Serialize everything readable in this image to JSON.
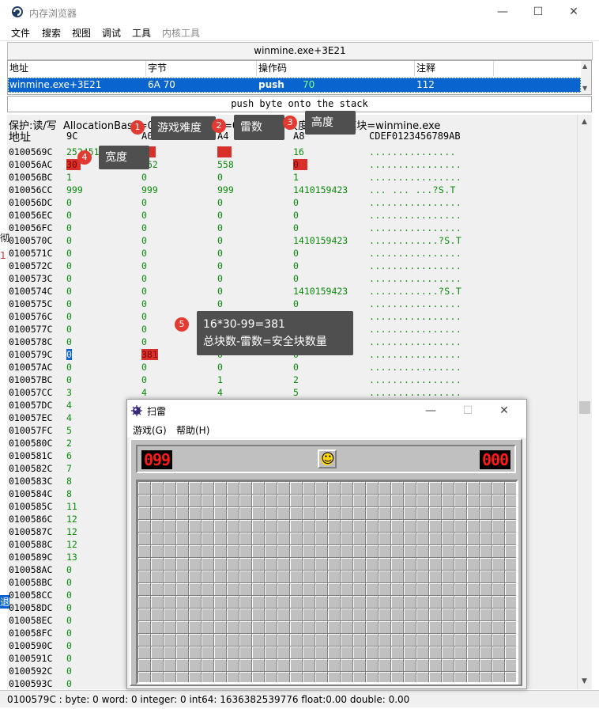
{
  "window": {
    "title": "内存浏览器",
    "minimize": "—",
    "maximize": "☐",
    "close": "✕"
  },
  "menu": [
    "文件",
    "搜索",
    "视图",
    "调试",
    "工具",
    "内核工具"
  ],
  "address_banner": "winmine.exe+3E21",
  "disasm": {
    "headers": [
      "地址",
      "字节",
      "操作码",
      "注释"
    ],
    "row": {
      "address": "winmine.exe+3E21",
      "bytes": "6A 70",
      "op": "push",
      "operand": "70",
      "comment": "112"
    }
  },
  "description": "push byte onto the stack",
  "info_line": "保护:读/写  AllocationBase=01000000 基址=01000000 尺度=1000 模块=winmine.exe",
  "address_header": "地址",
  "column_headers": [
    "9C",
    "A0",
    "A4",
    "A8",
    "CDEF0123456789AB"
  ],
  "hex_rows": [
    {
      "addr": "0100569C",
      "v": [
        "252451385",
        "",
        "",
        "16"
      ],
      "ascii": "...............",
      "hl": [
        1,
        2
      ]
    },
    {
      "addr": "010056AC",
      "v": [
        "30",
        "762",
        "558",
        "0"
      ],
      "ascii": "................",
      "hl": [
        0,
        3
      ]
    },
    {
      "addr": "010056BC",
      "v": [
        "1",
        "0",
        "0",
        "1"
      ],
      "ascii": "................",
      "hl": []
    },
    {
      "addr": "010056CC",
      "v": [
        "999",
        "999",
        "999",
        "1410159423"
      ],
      "ascii": " ... ... ...?S.T",
      "hl": []
    },
    {
      "addr": "010056DC",
      "v": [
        "0",
        "0",
        "0",
        "0"
      ],
      "ascii": "................",
      "hl": []
    },
    {
      "addr": "010056EC",
      "v": [
        "0",
        "0",
        "0",
        "0"
      ],
      "ascii": "................",
      "hl": []
    },
    {
      "addr": "010056FC",
      "v": [
        "0",
        "0",
        "0",
        "0"
      ],
      "ascii": "................",
      "hl": []
    },
    {
      "addr": "0100570C",
      "v": [
        "0",
        "0",
        "0",
        "1410159423"
      ],
      "ascii": "............?S.T",
      "hl": []
    },
    {
      "addr": "0100571C",
      "v": [
        "0",
        "0",
        "0",
        "0"
      ],
      "ascii": "................",
      "hl": []
    },
    {
      "addr": "0100572C",
      "v": [
        "0",
        "0",
        "0",
        "0"
      ],
      "ascii": "................",
      "hl": []
    },
    {
      "addr": "0100573C",
      "v": [
        "0",
        "0",
        "0",
        "0"
      ],
      "ascii": "................",
      "hl": []
    },
    {
      "addr": "0100574C",
      "v": [
        "0",
        "0",
        "0",
        "1410159423"
      ],
      "ascii": "............?S.T",
      "hl": []
    },
    {
      "addr": "0100575C",
      "v": [
        "0",
        "0",
        "0",
        "0"
      ],
      "ascii": "................",
      "hl": []
    },
    {
      "addr": "0100576C",
      "v": [
        "0",
        "0",
        "0",
        "0"
      ],
      "ascii": "................",
      "hl": []
    },
    {
      "addr": "0100577C",
      "v": [
        "0",
        "0",
        "0",
        "0"
      ],
      "ascii": "................",
      "hl": []
    },
    {
      "addr": "0100578C",
      "v": [
        "0",
        "0",
        "0",
        "0"
      ],
      "ascii": "................",
      "hl": []
    },
    {
      "addr": "0100579C",
      "v": [
        "0",
        "381",
        "0",
        "0"
      ],
      "ascii": "................",
      "hl": [
        1
      ]
    },
    {
      "addr": "010057AC",
      "v": [
        "0",
        "0",
        "0",
        "0"
      ],
      "ascii": "................",
      "hl": []
    },
    {
      "addr": "010057BC",
      "v": [
        "0",
        "0",
        "1",
        "2"
      ],
      "ascii": "................",
      "hl": []
    },
    {
      "addr": "010057CC",
      "v": [
        "3",
        "4",
        "4",
        "5"
      ],
      "ascii": "................",
      "hl": []
    },
    {
      "addr": "010057DC",
      "v": [
        "4",
        "",
        "",
        ""
      ],
      "ascii": "",
      "hl": []
    },
    {
      "addr": "010057EC",
      "v": [
        "4",
        "",
        "",
        ""
      ],
      "ascii": "",
      "hl": []
    },
    {
      "addr": "010057FC",
      "v": [
        "5",
        "",
        "",
        ""
      ],
      "ascii": "",
      "hl": []
    },
    {
      "addr": "0100580C",
      "v": [
        "2",
        "",
        "",
        ""
      ],
      "ascii": "",
      "hl": []
    },
    {
      "addr": "0100581C",
      "v": [
        "6",
        "",
        "",
        ""
      ],
      "ascii": "",
      "hl": []
    },
    {
      "addr": "0100582C",
      "v": [
        "7",
        "",
        "",
        ""
      ],
      "ascii": "",
      "hl": []
    },
    {
      "addr": "0100583C",
      "v": [
        "8",
        "",
        "",
        ""
      ],
      "ascii": "",
      "hl": []
    },
    {
      "addr": "0100584C",
      "v": [
        "8",
        "",
        "",
        ""
      ],
      "ascii": "",
      "hl": []
    },
    {
      "addr": "0100585C",
      "v": [
        "11",
        "",
        "",
        ""
      ],
      "ascii": "",
      "hl": []
    },
    {
      "addr": "0100586C",
      "v": [
        "12",
        "",
        "",
        ""
      ],
      "ascii": "",
      "hl": []
    },
    {
      "addr": "0100587C",
      "v": [
        "12",
        "",
        "",
        ""
      ],
      "ascii": "",
      "hl": []
    },
    {
      "addr": "0100588C",
      "v": [
        "12",
        "",
        "",
        ""
      ],
      "ascii": "",
      "hl": []
    },
    {
      "addr": "0100589C",
      "v": [
        "13",
        "",
        "",
        ""
      ],
      "ascii": "",
      "hl": []
    },
    {
      "addr": "010058AC",
      "v": [
        "0",
        "",
        "",
        ""
      ],
      "ascii": "",
      "hl": []
    },
    {
      "addr": "010058BC",
      "v": [
        "0",
        "",
        "",
        ""
      ],
      "ascii": "",
      "hl": []
    },
    {
      "addr": "010058CC",
      "v": [
        "0",
        "",
        "",
        ""
      ],
      "ascii": "",
      "hl": []
    },
    {
      "addr": "010058DC",
      "v": [
        "0",
        "",
        "",
        ""
      ],
      "ascii": "",
      "hl": []
    },
    {
      "addr": "010058EC",
      "v": [
        "0",
        "",
        "",
        ""
      ],
      "ascii": "",
      "hl": []
    },
    {
      "addr": "010058FC",
      "v": [
        "0",
        "",
        "",
        ""
      ],
      "ascii": "",
      "hl": []
    },
    {
      "addr": "0100590C",
      "v": [
        "0",
        "",
        "",
        ""
      ],
      "ascii": "",
      "hl": []
    },
    {
      "addr": "0100591C",
      "v": [
        "0",
        "",
        "",
        ""
      ],
      "ascii": "",
      "hl": []
    },
    {
      "addr": "0100592C",
      "v": [
        "0",
        "",
        "",
        ""
      ],
      "ascii": "",
      "hl": []
    },
    {
      "addr": "0100593C",
      "v": [
        "0",
        "",
        "",
        ""
      ],
      "ascii": "",
      "hl": []
    }
  ],
  "annotations": [
    {
      "num": "1",
      "text": "游戏难度"
    },
    {
      "num": "2",
      "text": "雷数"
    },
    {
      "num": "3",
      "text": "高度"
    },
    {
      "num": "4",
      "text": "宽度"
    },
    {
      "num": "5",
      "line1": "16*30-99=381",
      "line2": "总块数-雷数=安全块数量"
    }
  ],
  "status_bar": "0100579C : byte: 0 word: 0 integer: 0 int64: 1636382539776 float:0.00 double: 0.00",
  "edge_fragments": [
    "彻",
    "1",
    "退"
  ],
  "minesweeper": {
    "title": "扫雷",
    "menu": [
      "游戏(G)",
      "帮助(H)"
    ],
    "mines_counter": "099",
    "timer": "000",
    "smiley": "☺",
    "rows": 16,
    "cols": 30
  },
  "colors": {
    "selection": "#0a64d0",
    "highlight": "#d9302a",
    "value_green": "#0a8a0a",
    "badge": "#e23b32",
    "note_bg": "#4f4f4f"
  }
}
